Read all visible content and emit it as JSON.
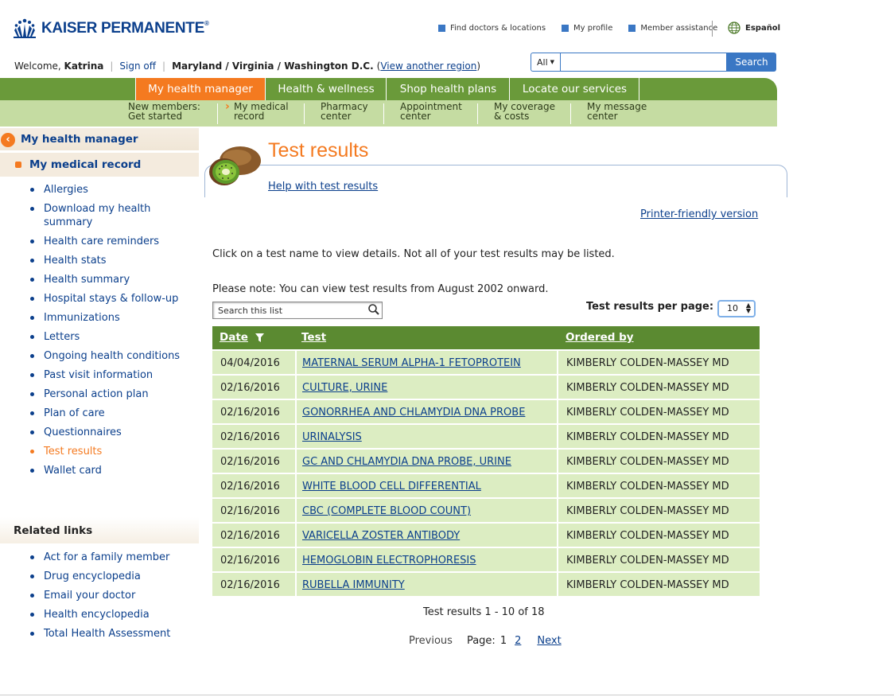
{
  "brand": {
    "name": "KAISER PERMANENTE",
    "reg": "®"
  },
  "top_links": [
    {
      "label": "Find doctors & locations"
    },
    {
      "label": "My profile"
    },
    {
      "label": "Member assistance"
    }
  ],
  "language": "Español",
  "welcome": {
    "prefix": "Welcome,",
    "name": "Katrina",
    "sign_off": "Sign off",
    "region": "Maryland / Virginia / Washington D.C.",
    "view_region": "View another region"
  },
  "search": {
    "scope": "All",
    "button": "Search",
    "placeholder": ""
  },
  "main_nav": [
    {
      "label": "My health manager",
      "active": true
    },
    {
      "label": "Health & wellness"
    },
    {
      "label": "Shop health plans"
    },
    {
      "label": "Locate our services"
    }
  ],
  "sub_nav": [
    {
      "line1": "New members:",
      "line2": "Get started"
    },
    {
      "line1": "My medical",
      "line2": "record"
    },
    {
      "line1": "Pharmacy",
      "line2": "center"
    },
    {
      "line1": "Appointment",
      "line2": "center"
    },
    {
      "line1": "My coverage",
      "line2": "& costs"
    },
    {
      "line1": "My message",
      "line2": "center"
    }
  ],
  "sidebar": {
    "section": "My health manager",
    "subsection": "My medical record",
    "items": [
      "Allergies",
      "Download my health summary",
      "Health care reminders",
      "Health stats",
      "Health summary",
      "Hospital stays & follow-up",
      "Immunizations",
      "Letters",
      "Ongoing health conditions",
      "Past visit information",
      "Personal action plan",
      "Plan of care",
      "Questionnaires",
      "Test results",
      "Wallet card"
    ],
    "current": "Test results",
    "related_title": "Related links",
    "related": [
      "Act for a family member",
      "Drug encyclopedia",
      "Email your doctor",
      "Health encyclopedia",
      "Total Health Assessment"
    ]
  },
  "content": {
    "title": "Test results",
    "help": "Help with test results",
    "printer": "Printer-friendly version",
    "intro": "Click on a test name to view details. Not all of your test results may be listed.",
    "note": "Please note: You can view test results from August 2002 onward.",
    "search_placeholder": "Search this list",
    "per_page_label": "Test results per page:",
    "per_page_value": "10",
    "columns": {
      "date": "Date",
      "test": "Test",
      "ordered": "Ordered by"
    },
    "rows": [
      {
        "date": "04/04/2016",
        "test": "MATERNAL SERUM ALPHA-1 FETOPROTEIN",
        "ordered": "KIMBERLY COLDEN-MASSEY MD"
      },
      {
        "date": "02/16/2016",
        "test": "CULTURE, URINE",
        "ordered": "KIMBERLY COLDEN-MASSEY MD"
      },
      {
        "date": "02/16/2016",
        "test": "GONORRHEA AND CHLAMYDIA DNA PROBE",
        "ordered": "KIMBERLY COLDEN-MASSEY MD"
      },
      {
        "date": "02/16/2016",
        "test": "URINALYSIS",
        "ordered": "KIMBERLY COLDEN-MASSEY MD"
      },
      {
        "date": "02/16/2016",
        "test": "GC AND CHLAMYDIA DNA PROBE, URINE",
        "ordered": "KIMBERLY COLDEN-MASSEY MD"
      },
      {
        "date": "02/16/2016",
        "test": "WHITE BLOOD CELL DIFFERENTIAL",
        "ordered": "KIMBERLY COLDEN-MASSEY MD"
      },
      {
        "date": "02/16/2016",
        "test": "CBC (COMPLETE BLOOD COUNT)",
        "ordered": "KIMBERLY COLDEN-MASSEY MD"
      },
      {
        "date": "02/16/2016",
        "test": "VARICELLA ZOSTER ANTIBODY",
        "ordered": "KIMBERLY COLDEN-MASSEY MD"
      },
      {
        "date": "02/16/2016",
        "test": "HEMOGLOBIN ELECTROPHORESIS",
        "ordered": "KIMBERLY COLDEN-MASSEY MD"
      },
      {
        "date": "02/16/2016",
        "test": "RUBELLA IMMUNITY",
        "ordered": "KIMBERLY COLDEN-MASSEY MD"
      }
    ],
    "summary": "Test results 1 - 10 of 18",
    "pager": {
      "previous": "Previous",
      "page_label": "Page:",
      "current": "1",
      "next_page": "2",
      "next": "Next"
    }
  },
  "colors": {
    "brand_blue": "#0b3f8c",
    "accent_orange": "#f47a20",
    "nav_green": "#6a9a3a",
    "row_green": "#dcedc2"
  },
  "icons": [
    "kp-logo-icon",
    "globe-icon",
    "search-icon",
    "back-arrow-icon",
    "kiwi-image"
  ]
}
